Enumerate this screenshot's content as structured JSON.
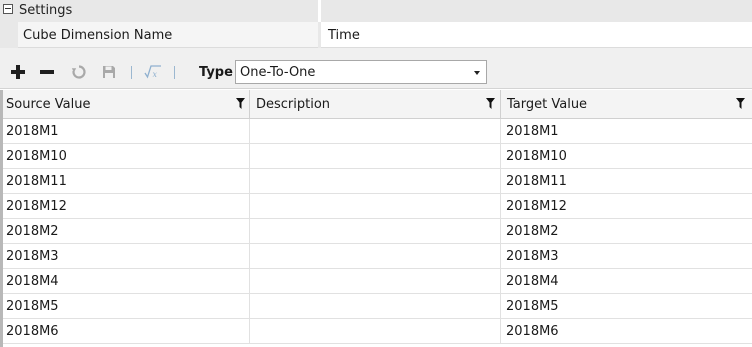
{
  "settings": {
    "title": "Settings",
    "properties": [
      {
        "name": "Cube Dimension Name",
        "value": "Time"
      }
    ]
  },
  "toolbar": {
    "icons": [
      "add-icon",
      "remove-icon",
      "refresh-icon",
      "save-icon",
      "formula-icon"
    ],
    "type_label": "Type",
    "type_value": "One-To-One"
  },
  "grid": {
    "columns": [
      "Source Value",
      "Description",
      "Target Value"
    ],
    "rows": [
      {
        "source": "2018M1",
        "description": "",
        "target": "2018M1"
      },
      {
        "source": "2018M10",
        "description": "",
        "target": "2018M10"
      },
      {
        "source": "2018M11",
        "description": "",
        "target": "2018M11"
      },
      {
        "source": "2018M12",
        "description": "",
        "target": "2018M12"
      },
      {
        "source": "2018M2",
        "description": "",
        "target": "2018M2"
      },
      {
        "source": "2018M3",
        "description": "",
        "target": "2018M3"
      },
      {
        "source": "2018M4",
        "description": "",
        "target": "2018M4"
      },
      {
        "source": "2018M5",
        "description": "",
        "target": "2018M5"
      },
      {
        "source": "2018M6",
        "description": "",
        "target": "2018M6"
      }
    ]
  },
  "colors": {
    "header_bg": "#e8e8e8",
    "toolbar_bg": "#f0f0f0",
    "disabled_icon": "#9bb7d0"
  }
}
